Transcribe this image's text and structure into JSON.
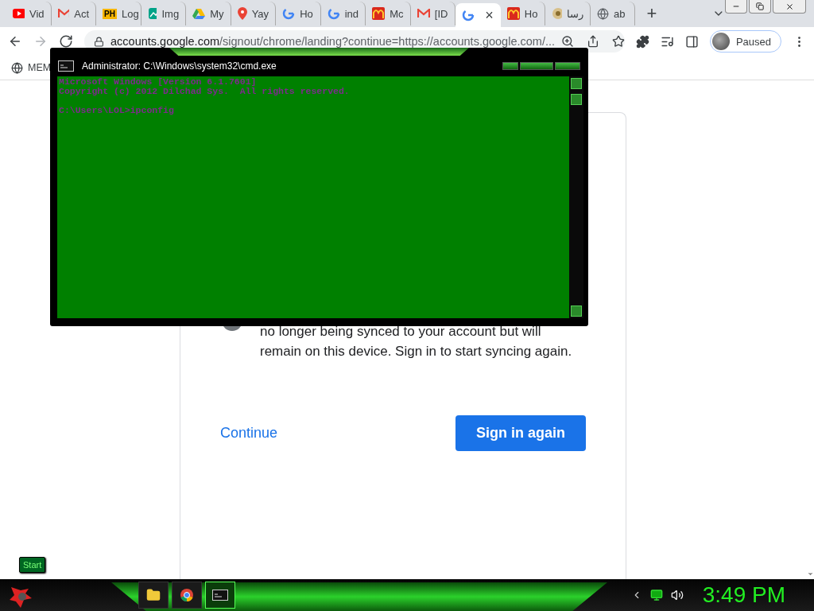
{
  "browser": {
    "tabs": [
      {
        "label": "Vid",
        "kind": "video",
        "selected": false
      },
      {
        "label": "Act",
        "kind": "mail",
        "selected": false
      },
      {
        "label": "Log",
        "kind": "badge",
        "badge": "PH",
        "selected": false
      },
      {
        "label": "Img",
        "kind": "image",
        "selected": false
      },
      {
        "label": "My",
        "kind": "drive",
        "selected": false
      },
      {
        "label": "Yay",
        "kind": "pin",
        "selected": false
      },
      {
        "label": "Ho",
        "kind": "search",
        "selected": false
      },
      {
        "label": "ind",
        "kind": "search",
        "selected": false
      },
      {
        "label": "Mc",
        "kind": "arches",
        "selected": false
      },
      {
        "label": "[ID",
        "kind": "mail",
        "selected": false
      },
      {
        "label": "×",
        "kind": "search",
        "selected": true
      },
      {
        "label": "Ho",
        "kind": "arches",
        "selected": false
      },
      {
        "label": "رسا",
        "kind": "emblem",
        "selected": false
      },
      {
        "label": "ab",
        "kind": "globe",
        "selected": false
      }
    ],
    "new_tab": "+",
    "address": {
      "host": "accounts.google.com",
      "path": "/signout/chrome/landing?continue=https://accounts.google.com/..."
    },
    "profile": {
      "label": "Paused"
    },
    "bookmarks": [
      {
        "label": "MEM"
      }
    ]
  },
  "page": {
    "message": "no longer being synced to your account but will remain on this device. Sign in to start syncing again.",
    "secondary_button": "Continue",
    "primary_button": "Sign in again"
  },
  "console": {
    "title": "Administrator: C:\\Windows\\system32\\cmd.exe",
    "lines": [
      "Microsoft Windows [Version 6.1.7601]",
      "Copyright (c) 2012 Dilchad Sys.  All rights reserved.",
      "C:\\Users\\LOL>ipconfig"
    ]
  },
  "taskbar": {
    "start_tip": "Start",
    "apps": [
      {
        "kind": "folder",
        "selected": false
      },
      {
        "kind": "chrome",
        "selected": false
      },
      {
        "kind": "console",
        "selected": true
      }
    ],
    "clock": "3:49 PM"
  }
}
